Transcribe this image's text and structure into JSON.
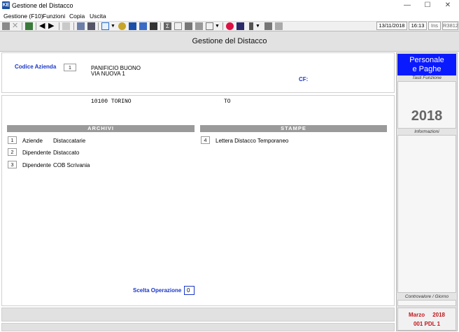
{
  "window": {
    "title": "Gestione del Distacco",
    "app_icon_text": "KE"
  },
  "menu": [
    "Gestione (F10)",
    "Funzioni",
    "Copia",
    "Uscita"
  ],
  "status": {
    "date": "13/11/2018",
    "time": "16:13",
    "mode": "Ins",
    "code": "R3812"
  },
  "page_title": "Gestione del Distacco",
  "azienda": {
    "label": "Codice Azienda",
    "code": "1",
    "name": "PANIFICIO BUONO",
    "street": "VIA NUOVA 1",
    "cf_label": "CF:",
    "city_line": "10100 TORINO",
    "province": "TO"
  },
  "archivi": {
    "header": "ARCHIVI",
    "items": [
      {
        "num": "1",
        "label": "Aziende",
        "extra": "Distaccatarie"
      },
      {
        "num": "2",
        "label": "Dipendente",
        "extra": "Distaccato"
      },
      {
        "num": "3",
        "label": "Dipendente",
        "extra": "COB Scrivania"
      }
    ]
  },
  "stampe": {
    "header": "STAMPE",
    "items": [
      {
        "num": "4",
        "label": "Lettera Distacco Temporaneo"
      }
    ]
  },
  "scelta": {
    "label": "Scelta Operazione",
    "value": "0"
  },
  "side": {
    "brand_line1": "Personale",
    "brand_line2": "e Paghe",
    "tasti_label": "Tasti Funzione",
    "year": "2018",
    "info_label": "Informazioni",
    "controvalore_label": "Controvalore / Giorno",
    "period": "Marzo     2018",
    "pdl": "001 PDL 1"
  },
  "colors": {
    "brand_blue": "#0a1aff",
    "label_blue": "#1a37c8",
    "period_red": "#c0161b"
  }
}
